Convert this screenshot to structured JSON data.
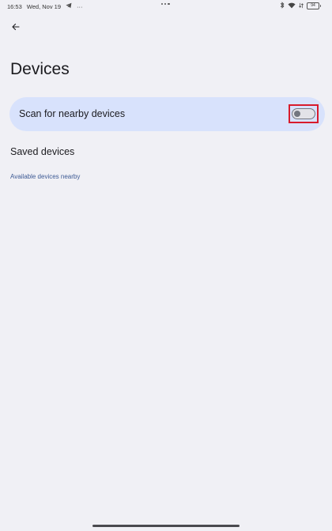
{
  "status_bar": {
    "time": "16:53",
    "date": "Wed, Nov 19",
    "overflow": "···",
    "battery": "94"
  },
  "page": {
    "title": "Devices"
  },
  "scan": {
    "label": "Scan for nearby devices",
    "toggle_on": false
  },
  "saved": {
    "label": "Saved devices"
  },
  "available": {
    "header": "Available devices nearby"
  },
  "colors": {
    "background": "#f0f0f5",
    "card": "#d8e2fc",
    "highlight": "#d81b2c",
    "section_header": "#3d5a94"
  }
}
